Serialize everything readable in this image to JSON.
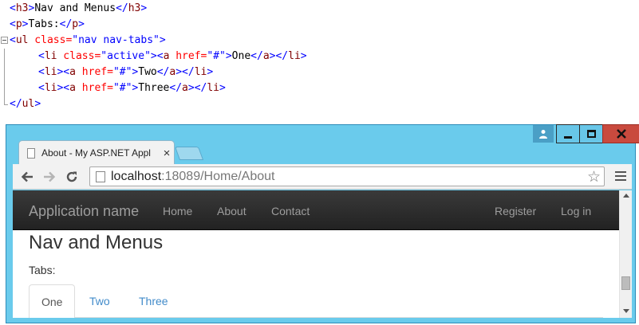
{
  "code": {
    "lines": [
      {
        "open": "<",
        "tag": "h3",
        "close": ">",
        "text": "Nav and Menus",
        "eopen": "</",
        "etag": "h3",
        "eclose": ">"
      },
      {
        "open": "<",
        "tag": "p",
        "close": ">",
        "text": "Tabs:",
        "eopen": "</",
        "etag": "p",
        "eclose": ">"
      },
      {
        "open": "<",
        "tag": "ul",
        "attr": " class=",
        "val": "\"nav nav-tabs\"",
        "close": ">"
      },
      {
        "open": "<",
        "tag": "li",
        "attr": " class=",
        "val": "\"active\"",
        "close": "><",
        "tag2": "a",
        "attr2": " href=",
        "val2": "\"#\"",
        "close2": ">",
        "text": "One",
        "eopen": "</",
        "etag": "a",
        "eclose": "></",
        "etag2": "li",
        "eclose2": ">"
      },
      {
        "open": "<",
        "tag": "li",
        "close": "><",
        "tag2": "a",
        "attr2": " href=",
        "val2": "\"#\"",
        "close2": ">",
        "text": "Two",
        "eopen": "</",
        "etag": "a",
        "eclose": "></",
        "etag2": "li",
        "eclose2": ">"
      },
      {
        "open": "<",
        "tag": "li",
        "close": "><",
        "tag2": "a",
        "attr2": " href=",
        "val2": "\"#\"",
        "close2": ">",
        "text": "Three",
        "eopen": "</",
        "etag": "a",
        "eclose": "></",
        "etag2": "li",
        "eclose2": ">"
      },
      {
        "eopen": "</",
        "etag": "ul",
        "eclose": ">"
      }
    ]
  },
  "browser": {
    "tab_title": "About - My ASP.NET Appl",
    "tab_close": "×",
    "url_host": "localhost",
    "url_rest": ":18089/Home/About",
    "star": "☆"
  },
  "site": {
    "brand": "Application name",
    "nav": [
      "Home",
      "About",
      "Contact"
    ],
    "nav_right": [
      "Register",
      "Log in"
    ],
    "heading": "Nav and Menus",
    "tabs_label": "Tabs:",
    "tabs": [
      "One",
      "Two",
      "Three"
    ]
  },
  "colors": {
    "window_frame": "#6acbec",
    "close_button": "#c94a3e",
    "navbar": "#222222",
    "link": "#428bca"
  },
  "icons": [
    "user-icon",
    "minimize-icon",
    "maximize-icon",
    "close-icon",
    "back-icon",
    "forward-icon",
    "reload-icon",
    "page-icon",
    "star-icon",
    "menu-icon"
  ]
}
